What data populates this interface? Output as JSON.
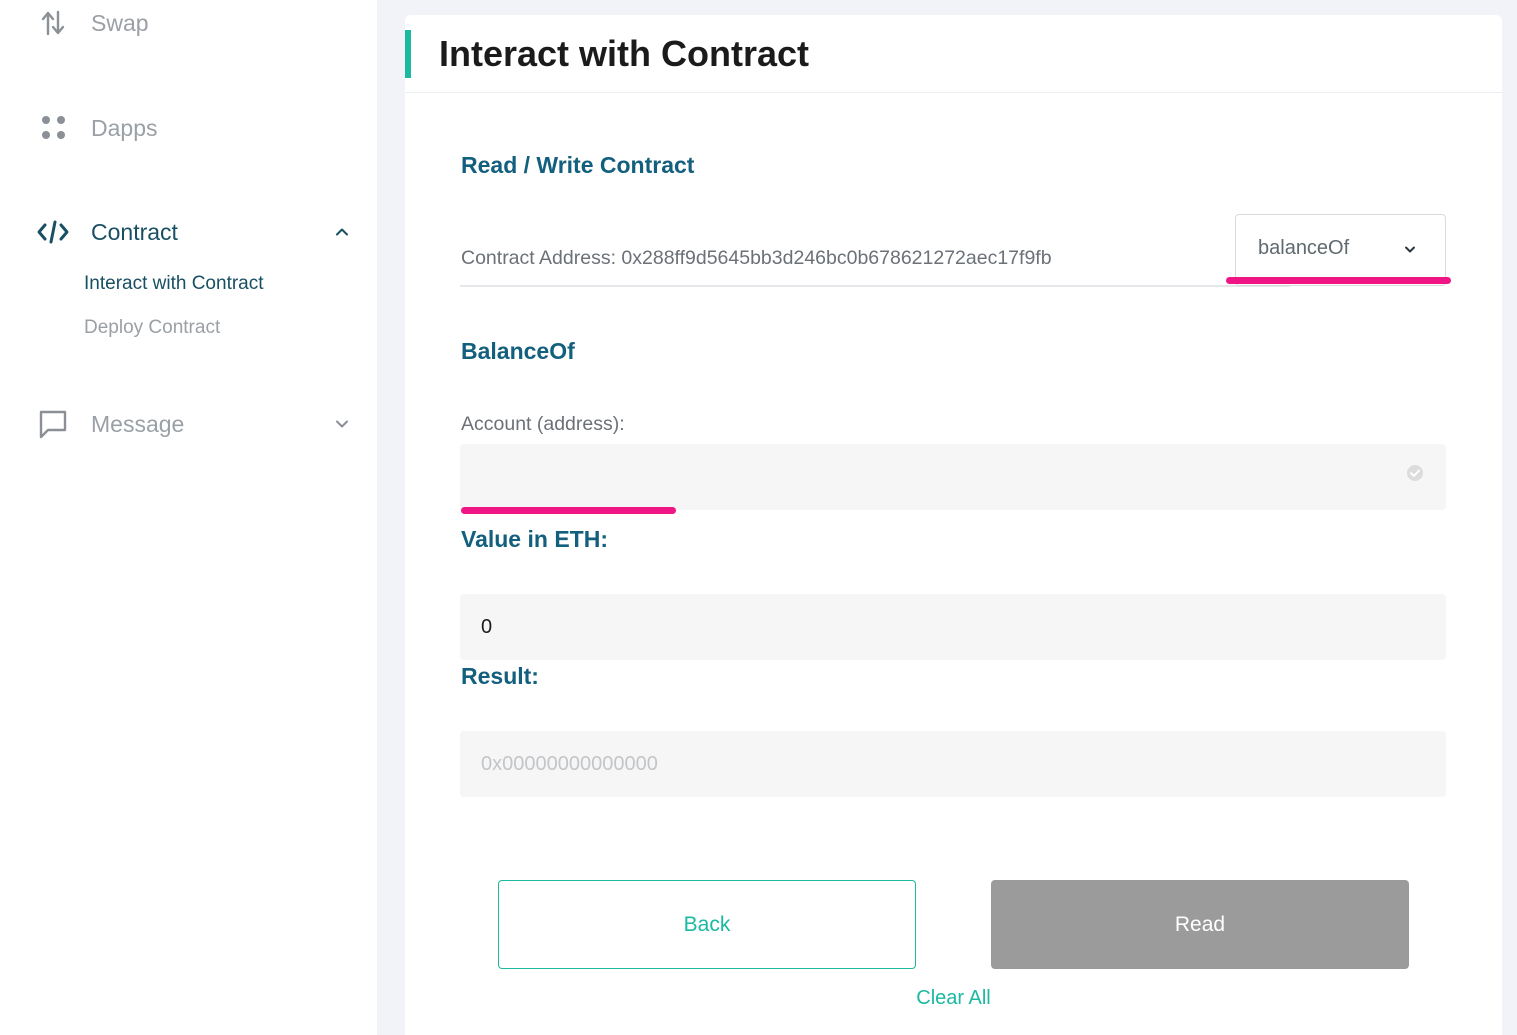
{
  "sidebar": {
    "items": [
      {
        "label": "Swap",
        "icon": "swap-icon"
      },
      {
        "label": "Dapps",
        "icon": "dapps-icon"
      },
      {
        "label": "Contract",
        "icon": "code-icon",
        "expanded": true,
        "children": [
          {
            "label": "Interact with Contract",
            "active": true
          },
          {
            "label": "Deploy Contract",
            "active": false
          }
        ]
      },
      {
        "label": "Message",
        "icon": "message-icon",
        "expanded": false
      }
    ]
  },
  "main": {
    "title": "Interact with Contract",
    "section_title": "Read / Write Contract",
    "contract_address_text": "Contract Address: 0x288ff9d5645bb3d246bc0b678621272aec17f9fb",
    "method_select": {
      "selected": "balanceOf"
    },
    "method_title": "BalanceOf",
    "account_field": {
      "label": "Account (address):",
      "value": "",
      "placeholder": ""
    },
    "value_field": {
      "label": "Value in ETH:",
      "value": "0"
    },
    "result_field": {
      "label": "Result:",
      "placeholder": "0x00000000000000"
    },
    "buttons": {
      "back": "Back",
      "read": "Read",
      "clear_all": "Clear All"
    }
  },
  "colors": {
    "accent": "#1bb9a0",
    "heading": "#135f7e",
    "highlight": "#f01584",
    "disabled_button": "#9b9b9b"
  }
}
